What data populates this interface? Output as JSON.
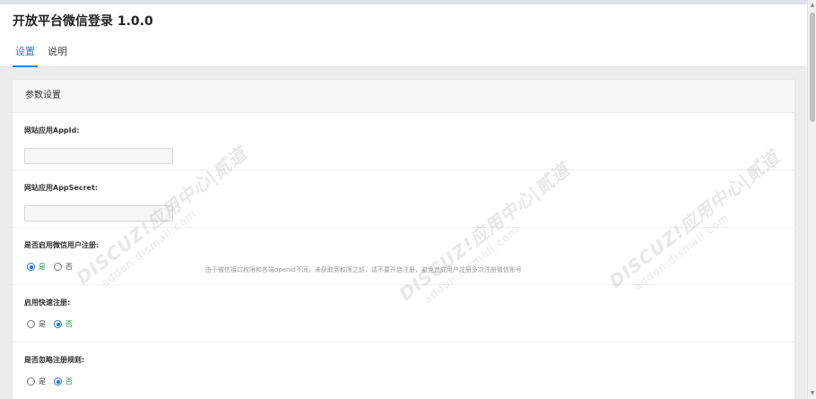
{
  "app": {
    "title": "开放平台微信登录 1.0.0"
  },
  "tabs": [
    {
      "label": "设置",
      "active": true
    },
    {
      "label": "说明",
      "active": false
    }
  ],
  "panel": {
    "title": "参数设置"
  },
  "fields": {
    "appid": {
      "label": "网站应用AppId:",
      "value": ""
    },
    "appsecret": {
      "label": "网站应用AppSecret:",
      "value": ""
    },
    "enable_register": {
      "label": "是否启用微信用户注册:",
      "options": [
        "是",
        "否"
      ],
      "selected": "是",
      "hint": "由于微信接口权限和各端openid不同，未获取到权限之前，请不要开启注册，避免造成用户注册多次注册微信账号"
    },
    "quick_register": {
      "label": "启用快速注册:",
      "options": [
        "是",
        "否"
      ],
      "selected": "否"
    },
    "ignore_rules": {
      "label": "是否忽略注册规则:",
      "options": [
        "是",
        "否"
      ],
      "selected": "否"
    }
  },
  "watermark": {
    "brand": "DISCUZ!应用中心|贰道",
    "site": "addon.dismall.com"
  },
  "colors": {
    "accent": "#1e88c8",
    "radio_checked": "#1e73d8",
    "selected_text": "#1a9a3a"
  }
}
